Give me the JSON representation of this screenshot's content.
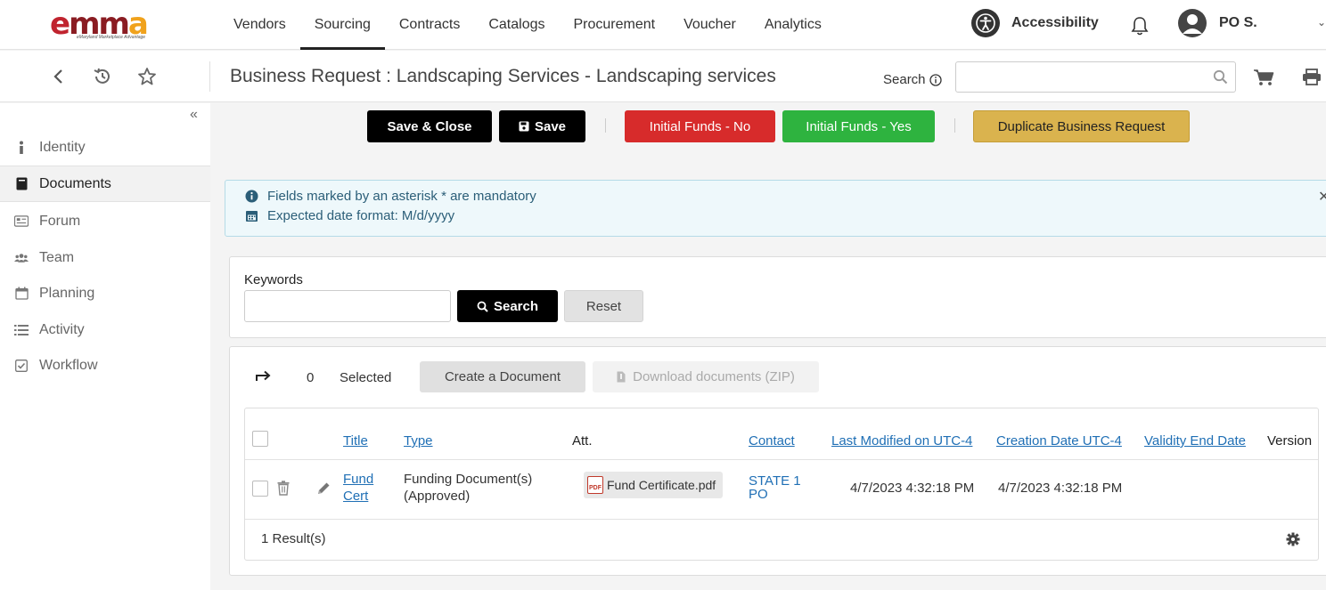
{
  "brand": {
    "logo_text_e": "e",
    "logo_text_m": "mm",
    "logo_text_a": "a",
    "tagline": "eMaryland Marketplace Advantage"
  },
  "nav": {
    "items": [
      "Vendors",
      "Sourcing",
      "Contracts",
      "Catalogs",
      "Procurement",
      "Voucher",
      "Analytics"
    ],
    "active": "Sourcing",
    "accessibility_label": "Accessibility",
    "user_label": "PO S."
  },
  "subbar": {
    "title": "Business Request : Landscaping Services - Landscaping services",
    "search_label": "Search",
    "search_value": ""
  },
  "sidebar": {
    "items": [
      {
        "label": "Identity",
        "icon": "info-icon"
      },
      {
        "label": "Documents",
        "icon": "book-icon"
      },
      {
        "label": "Forum",
        "icon": "forum-icon"
      },
      {
        "label": "Team",
        "icon": "team-icon"
      },
      {
        "label": "Planning",
        "icon": "calendar-icon"
      },
      {
        "label": "Activity",
        "icon": "list-icon"
      },
      {
        "label": "Workflow",
        "icon": "checkbox-icon"
      }
    ],
    "active": "Documents"
  },
  "toolbar": {
    "save_close": "Save & Close",
    "save": "Save",
    "initial_funds_no": "Initial Funds - No",
    "initial_funds_yes": "Initial Funds - Yes",
    "duplicate": "Duplicate Business Request"
  },
  "info": {
    "mandatory": "Fields marked by an asterisk * are mandatory",
    "date_format": "Expected date format: M/d/yyyy"
  },
  "keywords": {
    "label": "Keywords",
    "value": "",
    "search": "Search",
    "reset": "Reset"
  },
  "documents": {
    "selected_count": "0",
    "selected_label": "Selected",
    "create": "Create a Document",
    "download": "Download documents (ZIP)",
    "columns": {
      "title": "Title",
      "type": "Type",
      "att": "Att.",
      "contact": "Contact",
      "last_modified": "Last Modified on UTC-4",
      "creation": "Creation Date UTC-4",
      "validity": "Validity End Date",
      "version": "Version"
    },
    "rows": [
      {
        "title_line1": "Fund",
        "title_line2": "Cert",
        "type_line1": "Funding Document(s)",
        "type_line2": "(Approved)",
        "attachment": "Fund Certificate.pdf",
        "contact_line1": "STATE 1",
        "contact_line2": "PO",
        "last_modified": "4/7/2023 4:32:18 PM",
        "creation": "4/7/2023 4:32:18 PM",
        "validity": "",
        "version": ""
      }
    ],
    "results": "1 Result(s)"
  },
  "colors": {
    "black_button": "#000000",
    "red_button": "#d72b2b",
    "green_button": "#2eb33f",
    "gold_button": "#dab34e",
    "link": "#1f6fb5",
    "info_bg": "#eef8fb"
  }
}
